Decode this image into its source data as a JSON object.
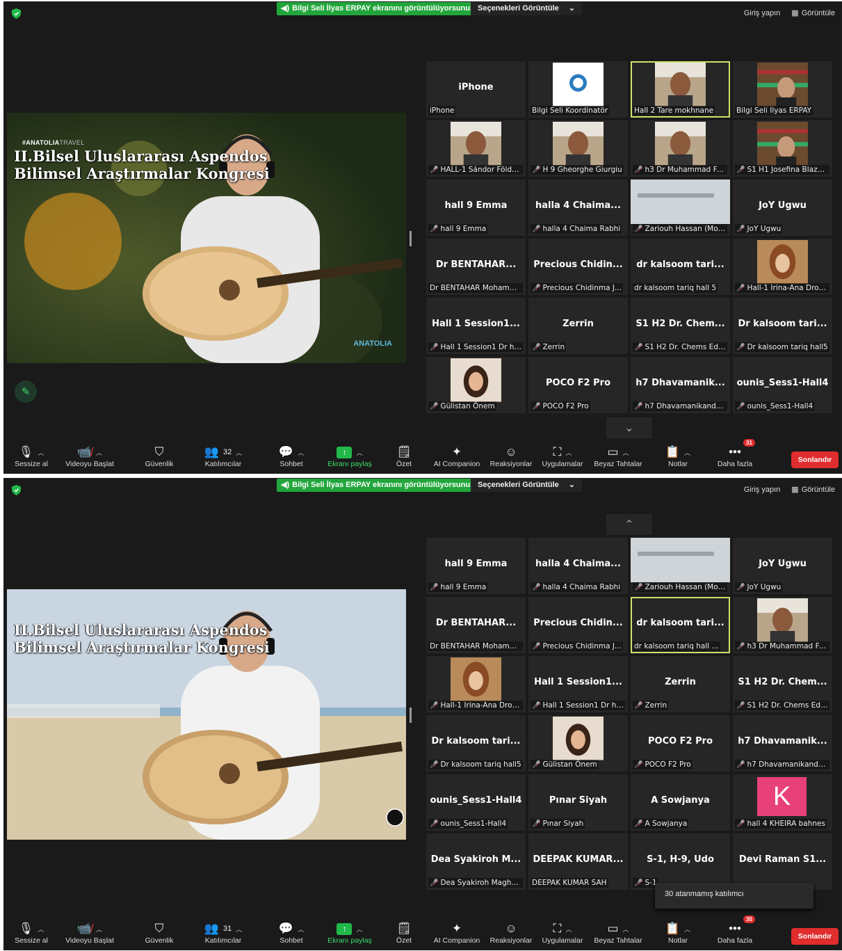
{
  "banner": {
    "text": "Bilgi Seli İlyas ERPAY ekranını görüntülüyorsunuz",
    "view_options": "Seçenekleri Görüntüle"
  },
  "topbar": {
    "signin": "Giriş yapın",
    "view": "Görüntüle"
  },
  "video1": {
    "tag": "#ANATOLIA",
    "tag2": "TRAVEL",
    "title1": "II.Bilsel Uluslararası Aspendos",
    "title2": "Bilimsel Araştırmalar Kongresi",
    "logo": "ANATOLIA"
  },
  "video2": {
    "title1": "II.Bilsel Uluslararası Aspendos",
    "title2": "Bilimsel Araştırmalar Kongresi"
  },
  "toolbar": {
    "mute": "Sessize al",
    "video": "Videoyu Başlat",
    "security": "Güvenlik",
    "participants": "Katılımcılar",
    "chat": "Sohbet",
    "share": "Ekranı paylaş",
    "summary": "Özet",
    "ai": "AI Companion",
    "reactions": "Reaksiyonlar",
    "apps": "Uygulamalar",
    "whiteboard": "Beyaz Tahtalar",
    "notes": "Notlar",
    "more": "Daha fazla",
    "end": "Sonlandır"
  },
  "screen1": {
    "participant_count": "32",
    "more_badge": "31",
    "tiles": [
      {
        "big": "iPhone",
        "label": "iPhone",
        "muted": false
      },
      {
        "big": "",
        "label": "Bilgi Seli Koordinatör",
        "muted": false,
        "photo": "logo"
      },
      {
        "big": "",
        "label": "Hall 2 Tare mokhnane",
        "muted": false,
        "photo": "face",
        "active": true
      },
      {
        "big": "",
        "label": "Bilgi Seli Ilyas ERPAY",
        "muted": false,
        "photo": "shelf"
      },
      {
        "big": "",
        "label": "HALL-1 Sándor Földv...",
        "muted": true,
        "photo": "face"
      },
      {
        "big": "",
        "label": "H 9 Gheorghe Giurgiu",
        "muted": true,
        "photo": "face"
      },
      {
        "big": "",
        "label": "h3 Dr Muhammad Fai...",
        "muted": true,
        "photo": "face"
      },
      {
        "big": "",
        "label": "S1 H1 Josefina Blazsa...",
        "muted": true,
        "photo": "shelf"
      },
      {
        "big": "hall 9 Emma",
        "label": "hall 9 Emma",
        "muted": true
      },
      {
        "big": "halla 4 Chaima...",
        "label": "halla 4 Chaima Rabhi",
        "muted": true
      },
      {
        "big": "",
        "label": "Zariouh Hassan (Mod...",
        "muted": true,
        "photo": "blur"
      },
      {
        "big": "JoY Ugwu",
        "label": "JoY Ugwu",
        "muted": true
      },
      {
        "big": "Dr BENTAHAR...",
        "label": "Dr BENTAHAR Mohamm...",
        "muted": false
      },
      {
        "big": "Precious Chidin...",
        "label": "Precious Chidinma J...",
        "muted": true
      },
      {
        "big": "dr kalsoom tari...",
        "label": "dr kalsoom tariq hall 5",
        "muted": false
      },
      {
        "big": "",
        "label": "Hall-1 Irina-Ana Drob...",
        "muted": true,
        "photo": "art"
      },
      {
        "big": "Hall 1 Session1...",
        "label": "Hall 1 Session1 Dr hc...",
        "muted": true
      },
      {
        "big": "Zerrin",
        "label": "Zerrin",
        "muted": true
      },
      {
        "big": "S1 H2 Dr. Chem...",
        "label": "S1 H2 Dr. Chems Edd...",
        "muted": true
      },
      {
        "big": "Dr kalsoom tari...",
        "label": "Dr kalsoom tariq hall5",
        "muted": true
      },
      {
        "big": "",
        "label": "Gülistan Önem",
        "muted": true,
        "photo": "girl"
      },
      {
        "big": "POCO F2 Pro",
        "label": "POCO F2 Pro",
        "muted": true
      },
      {
        "big": "h7 Dhavamanik...",
        "label": "h7 Dhavamanikandan...",
        "muted": true
      },
      {
        "big": "ounis_Sess1-Hall4",
        "label": "ounis_Sess1-Hall4",
        "muted": true
      }
    ]
  },
  "screen2": {
    "participant_count": "31",
    "more_badge": "30",
    "tooltip": "30 atanmamış katılımcı",
    "tiles": [
      {
        "big": "hall 9 Emma",
        "label": "hall 9 Emma",
        "muted": true
      },
      {
        "big": "halla 4 Chaima...",
        "label": "halla 4 Chaima Rabhi",
        "muted": true
      },
      {
        "big": "",
        "label": "Zariouh Hassan (Mod...",
        "muted": true,
        "photo": "blur"
      },
      {
        "big": "JoY Ugwu",
        "label": "JoY Ugwu",
        "muted": true
      },
      {
        "big": "Dr BENTAHAR...",
        "label": "Dr BENTAHAR Mohamm...",
        "muted": false
      },
      {
        "big": "Precious Chidin...",
        "label": "Precious Chidinma J...",
        "muted": true
      },
      {
        "big": "dr kalsoom tari...",
        "label": "dr kalsoom tariq hall ...",
        "muted": false,
        "active": true
      },
      {
        "big": "",
        "label": "h3 Dr Muhammad Fai...",
        "muted": true,
        "photo": "face"
      },
      {
        "big": "",
        "label": "Hall-1 Irina-Ana Drob...",
        "muted": true,
        "photo": "art"
      },
      {
        "big": "Hall 1 Session1...",
        "label": "Hall 1 Session1 Dr hc...",
        "muted": true
      },
      {
        "big": "Zerrin",
        "label": "Zerrin",
        "muted": true
      },
      {
        "big": "S1 H2 Dr. Chem...",
        "label": "S1 H2 Dr. Chems Edd...",
        "muted": true
      },
      {
        "big": "Dr kalsoom tari...",
        "label": "Dr kalsoom tariq hall5",
        "muted": true
      },
      {
        "big": "",
        "label": "Gülistan Önem",
        "muted": true,
        "photo": "girl"
      },
      {
        "big": "POCO F2 Pro",
        "label": "POCO F2 Pro",
        "muted": true
      },
      {
        "big": "h7 Dhavamanik...",
        "label": "h7 Dhavamanikandan...",
        "muted": true
      },
      {
        "big": "ounis_Sess1-Hall4",
        "label": "ounis_Sess1-Hall4",
        "muted": true
      },
      {
        "big": "Pınar Siyah",
        "label": "Pınar Siyah",
        "muted": true
      },
      {
        "big": "A Sowjanya",
        "label": "A Sowjanya",
        "muted": true
      },
      {
        "big": "",
        "label": "hall 4 KHEIRA bahnes",
        "muted": true,
        "photo": "K",
        "avatar_letter": "K"
      },
      {
        "big": "Dea Syakiroh M...",
        "label": "Dea Syakiroh Maghfir...",
        "muted": true
      },
      {
        "big": "DEEPAK KUMAR...",
        "label": "DEEPAK KUMAR SAH",
        "muted": false
      },
      {
        "big": "S-1, H-9, Udo",
        "label": "S-1",
        "muted": true
      },
      {
        "big": "Devi Raman S1...",
        "label": "",
        "muted": false
      }
    ]
  }
}
